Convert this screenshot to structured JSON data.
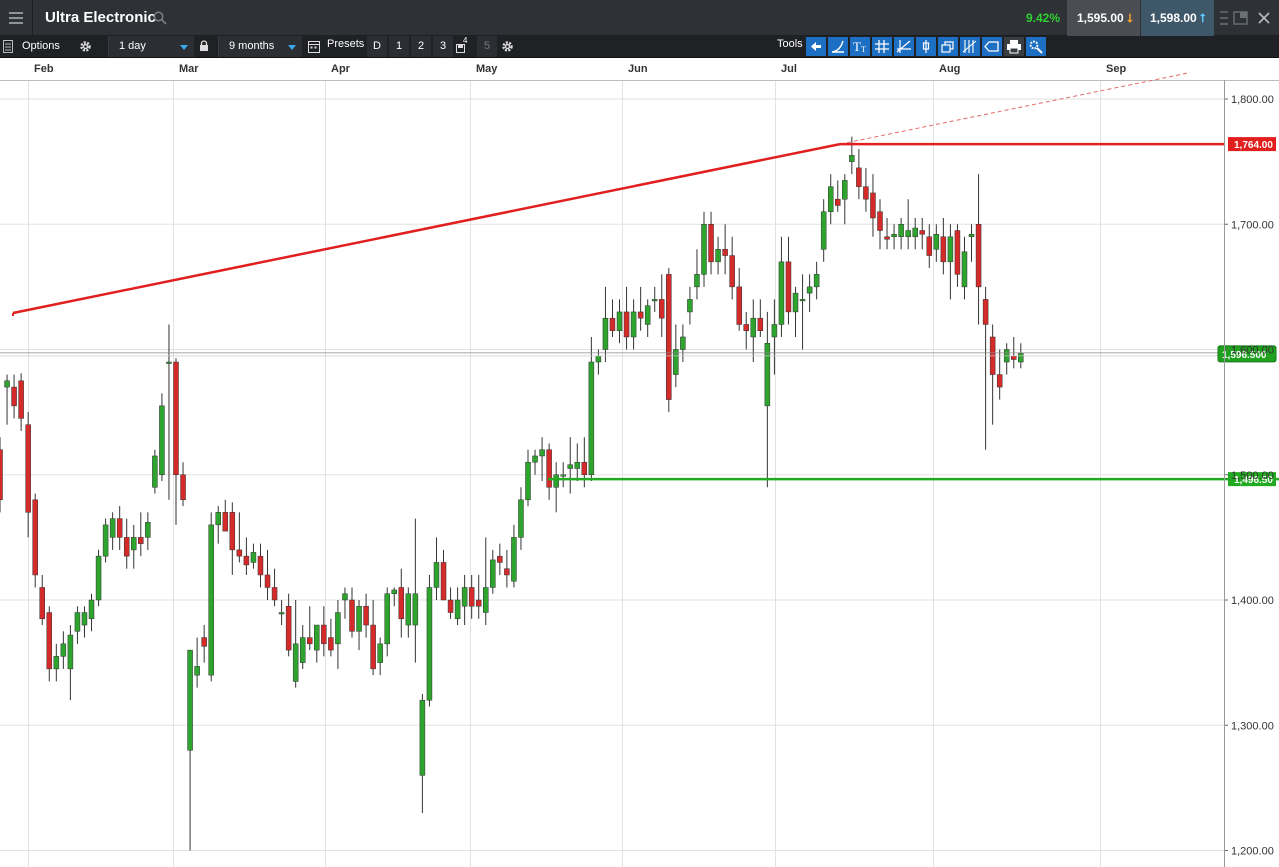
{
  "header": {
    "title": "Ultra Electronic",
    "change_pct": "9.42%",
    "sell_price": "1,595.00",
    "buy_price": "1,598.00"
  },
  "toolbar": {
    "options_label": "Options",
    "interval": "1 day",
    "range": "9 months",
    "presets_label": "Presets",
    "presets": [
      "D",
      "1",
      "2",
      "3",
      "4",
      "5"
    ],
    "tools_label": "Tools"
  },
  "icons": [
    "menu-icon",
    "search-icon",
    "gear-icon",
    "lock-icon",
    "calendar-icon",
    "save-icon",
    "print-icon",
    "settings-icon"
  ],
  "colors": {
    "up": "#2ea32e",
    "down": "#d42a2a",
    "resistance": "#e21f1f",
    "support": "#22aa22"
  },
  "chart_data": {
    "type": "candlestick",
    "months": [
      "Feb",
      "Mar",
      "Apr",
      "May",
      "Jun",
      "Jul",
      "Aug",
      "Sep"
    ],
    "ylim": [
      1110,
      1830
    ],
    "yticks": [
      "1,800.00",
      "1,700.00",
      "1,600.00",
      "1,500.00",
      "1,400.00",
      "1,300.00",
      "1,200.00"
    ],
    "lines": {
      "resistance_level": "1,764.00",
      "support_level": "1,496.50",
      "current_price": "1,596.500"
    },
    "candles": [
      [
        1520,
        1530,
        1470,
        1480
      ],
      [
        1570,
        1580,
        1540,
        1575
      ],
      [
        1570,
        1580,
        1545,
        1555
      ],
      [
        1575,
        1581,
        1535,
        1545
      ],
      [
        1540,
        1550,
        1450,
        1470
      ],
      [
        1480,
        1485,
        1410,
        1420
      ],
      [
        1410,
        1420,
        1380,
        1385
      ],
      [
        1390,
        1395,
        1335,
        1345
      ],
      [
        1345,
        1365,
        1335,
        1355
      ],
      [
        1355,
        1375,
        1345,
        1365
      ],
      [
        1345,
        1380,
        1320,
        1372
      ],
      [
        1375,
        1395,
        1365,
        1390
      ],
      [
        1380,
        1395,
        1370,
        1390
      ],
      [
        1385,
        1405,
        1375,
        1400
      ],
      [
        1400,
        1440,
        1395,
        1435
      ],
      [
        1435,
        1465,
        1430,
        1460
      ],
      [
        1450,
        1470,
        1440,
        1465
      ],
      [
        1465,
        1475,
        1440,
        1450
      ],
      [
        1450,
        1465,
        1425,
        1435
      ],
      [
        1440,
        1460,
        1425,
        1450
      ],
      [
        1450,
        1470,
        1435,
        1445
      ],
      [
        1450,
        1470,
        1440,
        1462
      ],
      [
        1490,
        1520,
        1485,
        1515
      ],
      [
        1500,
        1565,
        1495,
        1555
      ],
      [
        1590,
        1620,
        1480,
        1590
      ],
      [
        1590,
        1593,
        1460,
        1500
      ],
      [
        1500,
        1510,
        1475,
        1480
      ],
      [
        1280,
        1360,
        1200,
        1360
      ],
      [
        1340,
        1370,
        1330,
        1347
      ],
      [
        1370,
        1380,
        1350,
        1363
      ],
      [
        1340,
        1470,
        1335,
        1460
      ],
      [
        1460,
        1475,
        1445,
        1470
      ],
      [
        1470,
        1480,
        1455,
        1455
      ],
      [
        1470,
        1478,
        1420,
        1440
      ],
      [
        1440,
        1470,
        1430,
        1435
      ],
      [
        1435,
        1450,
        1420,
        1428
      ],
      [
        1430,
        1445,
        1425,
        1438
      ],
      [
        1435,
        1445,
        1410,
        1420
      ],
      [
        1420,
        1440,
        1400,
        1410
      ],
      [
        1410,
        1425,
        1395,
        1400
      ],
      [
        1390,
        1400,
        1380,
        1390
      ],
      [
        1395,
        1405,
        1355,
        1360
      ],
      [
        1335,
        1400,
        1330,
        1365
      ],
      [
        1350,
        1380,
        1345,
        1370
      ],
      [
        1370,
        1395,
        1360,
        1365
      ],
      [
        1360,
        1380,
        1350,
        1380
      ],
      [
        1380,
        1395,
        1355,
        1365
      ],
      [
        1370,
        1385,
        1355,
        1360
      ],
      [
        1365,
        1400,
        1345,
        1390
      ],
      [
        1400,
        1410,
        1385,
        1405
      ],
      [
        1400,
        1410,
        1370,
        1375
      ],
      [
        1375,
        1400,
        1360,
        1395
      ],
      [
        1395,
        1405,
        1370,
        1380
      ],
      [
        1380,
        1400,
        1340,
        1345
      ],
      [
        1350,
        1370,
        1340,
        1365
      ],
      [
        1365,
        1410,
        1355,
        1405
      ],
      [
        1405,
        1410,
        1395,
        1408
      ],
      [
        1410,
        1425,
        1370,
        1385
      ],
      [
        1380,
        1410,
        1370,
        1405
      ],
      [
        1380,
        1465,
        1350,
        1405
      ],
      [
        1260,
        1325,
        1230,
        1320
      ],
      [
        1320,
        1420,
        1315,
        1410
      ],
      [
        1410,
        1450,
        1400,
        1430
      ],
      [
        1430,
        1440,
        1400,
        1400
      ],
      [
        1400,
        1410,
        1385,
        1390
      ],
      [
        1385,
        1410,
        1380,
        1400
      ],
      [
        1395,
        1420,
        1380,
        1410
      ],
      [
        1410,
        1420,
        1385,
        1395
      ],
      [
        1400,
        1420,
        1385,
        1395
      ],
      [
        1390,
        1450,
        1380,
        1410
      ],
      [
        1410,
        1440,
        1405,
        1432
      ],
      [
        1435,
        1445,
        1420,
        1430
      ],
      [
        1425,
        1440,
        1410,
        1420
      ],
      [
        1415,
        1460,
        1410,
        1450
      ],
      [
        1450,
        1490,
        1440,
        1480
      ],
      [
        1480,
        1520,
        1475,
        1510
      ],
      [
        1510,
        1520,
        1500,
        1515
      ],
      [
        1515,
        1530,
        1495,
        1520
      ],
      [
        1520,
        1525,
        1480,
        1490
      ],
      [
        1490,
        1510,
        1470,
        1500
      ],
      [
        1500,
        1510,
        1490,
        1500
      ],
      [
        1505,
        1530,
        1485,
        1508
      ],
      [
        1505,
        1525,
        1495,
        1510
      ],
      [
        1510,
        1530,
        1490,
        1500
      ],
      [
        1500,
        1610,
        1495,
        1590
      ],
      [
        1590,
        1600,
        1580,
        1595
      ],
      [
        1600,
        1650,
        1590,
        1625
      ],
      [
        1625,
        1640,
        1610,
        1615
      ],
      [
        1615,
        1640,
        1605,
        1630
      ],
      [
        1630,
        1650,
        1600,
        1610
      ],
      [
        1610,
        1640,
        1600,
        1630
      ],
      [
        1630,
        1650,
        1615,
        1625
      ],
      [
        1620,
        1640,
        1610,
        1635
      ],
      [
        1640,
        1650,
        1630,
        1640
      ],
      [
        1640,
        1660,
        1610,
        1625
      ],
      [
        1660,
        1665,
        1550,
        1560
      ],
      [
        1580,
        1620,
        1570,
        1600
      ],
      [
        1600,
        1620,
        1590,
        1610
      ],
      [
        1630,
        1650,
        1620,
        1640
      ],
      [
        1650,
        1680,
        1640,
        1660
      ],
      [
        1660,
        1710,
        1650,
        1700
      ],
      [
        1700,
        1710,
        1660,
        1670
      ],
      [
        1670,
        1690,
        1660,
        1680
      ],
      [
        1680,
        1700,
        1660,
        1675
      ],
      [
        1675,
        1690,
        1640,
        1650
      ],
      [
        1650,
        1665,
        1615,
        1620
      ],
      [
        1620,
        1630,
        1600,
        1615
      ],
      [
        1610,
        1640,
        1590,
        1625
      ],
      [
        1625,
        1640,
        1610,
        1615
      ],
      [
        1555,
        1630,
        1490,
        1605
      ],
      [
        1610,
        1640,
        1580,
        1620
      ],
      [
        1620,
        1690,
        1610,
        1670
      ],
      [
        1670,
        1690,
        1620,
        1630
      ],
      [
        1630,
        1650,
        1610,
        1645
      ],
      [
        1640,
        1660,
        1600,
        1640
      ],
      [
        1645,
        1660,
        1630,
        1650
      ],
      [
        1650,
        1670,
        1640,
        1660
      ],
      [
        1680,
        1720,
        1670,
        1710
      ],
      [
        1710,
        1740,
        1700,
        1730
      ],
      [
        1720,
        1735,
        1710,
        1715
      ],
      [
        1720,
        1740,
        1700,
        1735
      ],
      [
        1750,
        1770,
        1740,
        1755
      ],
      [
        1745,
        1760,
        1720,
        1730
      ],
      [
        1730,
        1745,
        1710,
        1720
      ],
      [
        1725,
        1740,
        1690,
        1705
      ],
      [
        1710,
        1720,
        1680,
        1695
      ],
      [
        1690,
        1705,
        1680,
        1688
      ],
      [
        1690,
        1700,
        1680,
        1692
      ],
      [
        1690,
        1705,
        1680,
        1700
      ],
      [
        1690,
        1720,
        1680,
        1695
      ],
      [
        1690,
        1705,
        1680,
        1697
      ],
      [
        1695,
        1705,
        1680,
        1692
      ],
      [
        1690,
        1700,
        1665,
        1675
      ],
      [
        1680,
        1700,
        1670,
        1692
      ],
      [
        1690,
        1705,
        1660,
        1670
      ],
      [
        1670,
        1700,
        1640,
        1690
      ],
      [
        1695,
        1700,
        1650,
        1660
      ],
      [
        1650,
        1690,
        1640,
        1678
      ],
      [
        1690,
        1700,
        1670,
        1692
      ],
      [
        1700,
        1740,
        1620,
        1650
      ],
      [
        1640,
        1650,
        1520,
        1620
      ],
      [
        1610,
        1620,
        1540,
        1580
      ],
      [
        1580,
        1600,
        1560,
        1570
      ],
      [
        1590,
        1605,
        1580,
        1600
      ],
      [
        1595,
        1610,
        1585,
        1592
      ],
      [
        1590,
        1605,
        1585,
        1597
      ]
    ]
  }
}
